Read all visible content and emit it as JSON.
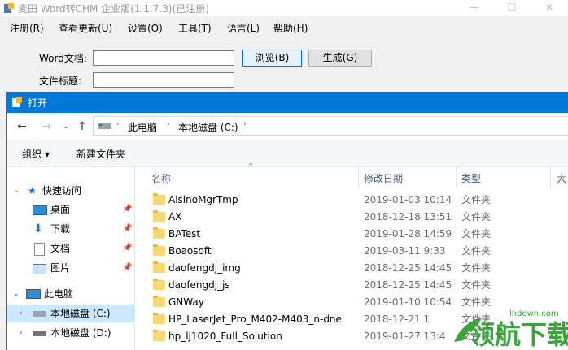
{
  "app": {
    "title": "麦田 Word转CHM 企业版(1.1.7.3)(已注册)",
    "menu": [
      "注册(R)",
      "查看更新(U)",
      "设置(O)",
      "工具(T)",
      "语言(L)",
      "帮助(H)"
    ],
    "word_doc_label": "Word文档:",
    "file_title_label": "文件标题:",
    "browse_button": "浏览(B)",
    "generate_button": "生成(G)",
    "word_doc_value": "",
    "file_title_value": ""
  },
  "dialog": {
    "title": "打开",
    "breadcrumb": [
      "此电脑",
      "本地磁盘 (C:)"
    ],
    "organize": "组织 ▾",
    "new_folder": "新建文件夹",
    "sidebar": [
      {
        "label": "快速访问",
        "icon": "star-icon"
      },
      {
        "label": "桌面",
        "icon": "desktop-icon"
      },
      {
        "label": "下载",
        "icon": "download-icon"
      },
      {
        "label": "文档",
        "icon": "document-icon"
      },
      {
        "label": "图片",
        "icon": "picture-icon"
      },
      {
        "label": "此电脑",
        "icon": "computer-icon"
      },
      {
        "label": "本地磁盘 (C:)",
        "icon": "drive-icon"
      },
      {
        "label": "本地磁盘 (D:)",
        "icon": "drive-icon"
      }
    ],
    "columns": [
      "名称",
      "修改日期",
      "类型",
      "大"
    ],
    "files": [
      {
        "name": "AisinoMgrTmp",
        "date": "2019-01-03 10:14",
        "type": "文件夹"
      },
      {
        "name": "AX",
        "date": "2018-12-18 13:51",
        "type": "文件夹"
      },
      {
        "name": "BATest",
        "date": "2019-01-28 14:59",
        "type": "文件夹"
      },
      {
        "name": "Boaosoft",
        "date": "2019-03-11 9:33",
        "type": "文件夹"
      },
      {
        "name": "daofengdj_img",
        "date": "2018-12-25 14:45",
        "type": "文件夹"
      },
      {
        "name": "daofengdj_js",
        "date": "2018-12-25 14:45",
        "type": "文件夹"
      },
      {
        "name": "GNWay",
        "date": "2019-01-10 10:54",
        "type": "文件夹"
      },
      {
        "name": "HP_LaserJet_Pro_M402-M403_n-dne",
        "date": "2018-12-21 1",
        "type": "文件夹"
      },
      {
        "name": "hp_lj1020_Full_Solution",
        "date": "2019-01-27 13:4",
        "type": "文件夹"
      }
    ]
  },
  "watermark": {
    "text": "领航下载",
    "url": "lhdown.com"
  },
  "colors": {
    "accent": "#0078d7",
    "selected": "#cce8ff",
    "folder": "#f8d775",
    "watermark": "#3aa53a"
  }
}
